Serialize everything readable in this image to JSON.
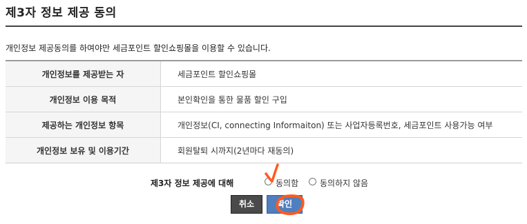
{
  "page": {
    "title": "제3자 정보 제공 동의",
    "intro": "개인정보 제공동의를 하여야만 세금포인트 할인쇼핑몰을 이용할 수 있습니다."
  },
  "info_table": {
    "rows": [
      {
        "label": "개인정보를 제공받는 자",
        "value": "세금포인트 할인쇼핑몰"
      },
      {
        "label": "개인정보 이용 목적",
        "value": "본인확인을 통한 물품 할인 구입"
      },
      {
        "label": "제공하는 개인정보 항목",
        "value": "개인정보(CI, connecting Informaiton) 또는 사업자등록번호, 세금포인트 사용가능 여부"
      },
      {
        "label": "개인정보 보유 및 이용기간",
        "value": "회원탈퇴 시까지(2년마다 재동의)"
      }
    ]
  },
  "consent": {
    "label": "제3자 정보 제공에 대해",
    "options": [
      {
        "label": "동의함"
      },
      {
        "label": "동의하지 않음"
      }
    ]
  },
  "buttons": {
    "cancel": "취소",
    "confirm": "확인"
  },
  "annotations": {
    "color": "#ff5a1f",
    "marks": [
      "checkmark-annotation",
      "circle-annotation"
    ]
  }
}
